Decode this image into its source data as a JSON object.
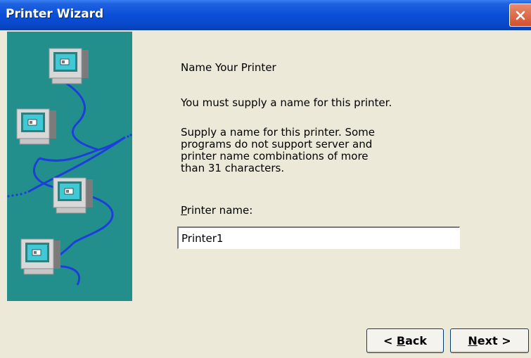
{
  "window": {
    "title": "Printer Wizard"
  },
  "wizard": {
    "heading": "Name Your Printer",
    "subtitle": "You must supply a name for this printer.",
    "description": [
      "Supply a name for this printer. Some",
      "programs do not support server and",
      "printer name combinations of more",
      "than 31 characters."
    ],
    "label_mnemonic": "P",
    "label_rest": "rinter name:",
    "printer_name_value": "Printer1"
  },
  "buttons": {
    "back_prefix": "< ",
    "back_mnemonic": "B",
    "back_rest": "ack",
    "next_mnemonic": "N",
    "next_rest": "ext >"
  },
  "colors": {
    "title_bar": "#0a4fd8",
    "art_background": "#238f8d",
    "network_line": "#1d3fd9",
    "close_button": "#d1502d"
  },
  "icons": [
    "close-icon",
    "network-computers-illustration"
  ]
}
